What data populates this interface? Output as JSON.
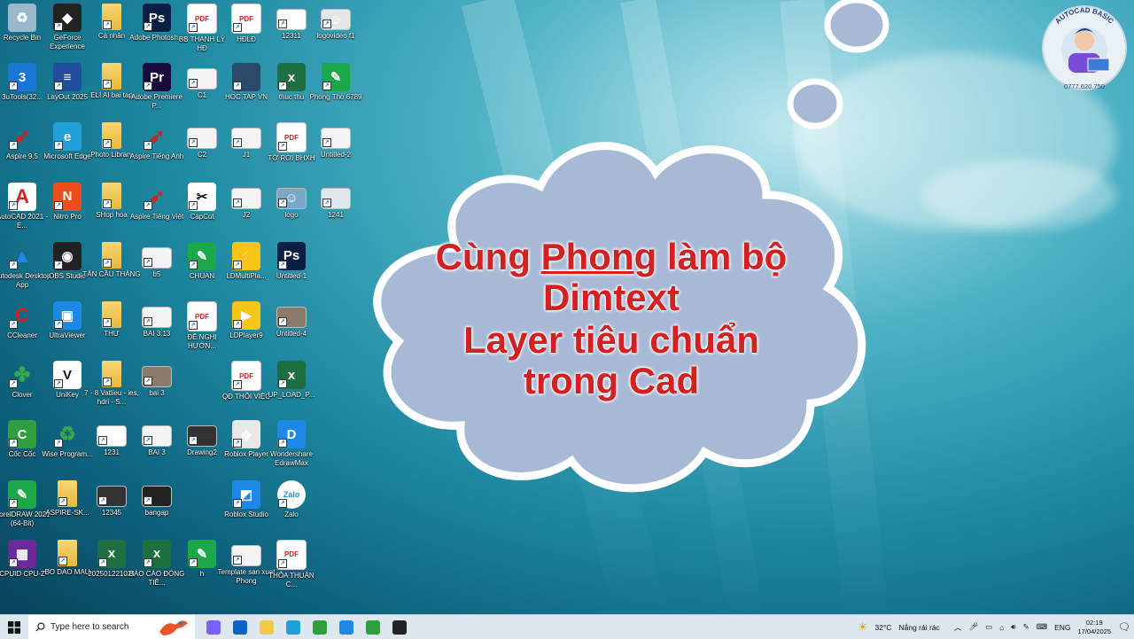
{
  "desktop": {
    "icons": [
      {
        "label": "Recycle Bin",
        "icon": "recycle-bin-icon",
        "color": "#9ab8cc",
        "glyph": "♻"
      },
      {
        "label": "GeForce Experience",
        "icon": "geforce-icon",
        "color": "#222",
        "glyph": "◆"
      },
      {
        "label": "Cá nhân",
        "icon": "folder-icon",
        "color": "#f2c94c",
        "glyph": ""
      },
      {
        "label": "Adobe Photosh...",
        "icon": "photoshop-icon",
        "color": "#0a1f44",
        "glyph": "Ps"
      },
      {
        "label": "BB THANH LÝ HĐ",
        "icon": "pdf-icon",
        "color": "#ffffff",
        "glyph": "PDF"
      },
      {
        "label": "HĐLĐ",
        "icon": "pdf-icon",
        "color": "#ffffff",
        "glyph": "PDF"
      },
      {
        "label": "12311",
        "icon": "file-icon",
        "color": "#ffffff",
        "glyph": ""
      },
      {
        "label": "logovideo f1",
        "icon": "image-icon",
        "color": "#e6e6e6",
        "glyph": "☺"
      },
      {
        "label": "3uTools(32...",
        "icon": "3utools-icon",
        "color": "#1976d2",
        "glyph": "3"
      },
      {
        "label": "LayOut 2025",
        "icon": "layout-icon",
        "color": "#1e4e9c",
        "glyph": "≡"
      },
      {
        "label": "ELI AI bai tap",
        "icon": "folder-icon",
        "color": "#f2c94c",
        "glyph": ""
      },
      {
        "label": "Adobe Premiere P...",
        "icon": "premiere-icon",
        "color": "#1a0b3d",
        "glyph": "Pr"
      },
      {
        "label": "C1",
        "icon": "image-icon",
        "color": "#f4f4f4",
        "glyph": ""
      },
      {
        "label": "HOC TAP VN",
        "icon": "dark-file-icon",
        "color": "#2b4a6a",
        "glyph": ""
      },
      {
        "label": "thuc thu",
        "icon": "excel-icon",
        "color": "#1d6f42",
        "glyph": "x"
      },
      {
        "label": "Phong Tho 6789",
        "icon": "coreldraw-icon",
        "color": "#1aa84a",
        "glyph": "✎"
      },
      {
        "label": "Aspire 9.5",
        "icon": "aspire-icon",
        "color": "transparent",
        "glyph": "➶"
      },
      {
        "label": "Microsoft Edge",
        "icon": "edge-icon",
        "color": "#1fa0d6",
        "glyph": "e"
      },
      {
        "label": "Photo Library",
        "icon": "folder-icon",
        "color": "#f2c94c",
        "glyph": ""
      },
      {
        "label": "Aspire Tiếng Anh",
        "icon": "aspire-icon",
        "color": "transparent",
        "glyph": "➶"
      },
      {
        "label": "C2",
        "icon": "image-icon",
        "color": "#f4f4f4",
        "glyph": ""
      },
      {
        "label": "J1",
        "icon": "image-icon",
        "color": "#f4f4f4",
        "glyph": ""
      },
      {
        "label": "TỜ RỜI BHXH",
        "icon": "pdf-icon",
        "color": "#ffffff",
        "glyph": "PDF"
      },
      {
        "label": "Untitled-2",
        "icon": "image-icon",
        "color": "#f4f4f4",
        "glyph": ""
      },
      {
        "label": "AutoCAD 2021 - E...",
        "icon": "autocad-icon",
        "color": "#ffffff",
        "glyph": "A"
      },
      {
        "label": "Nitro Pro",
        "icon": "nitro-icon",
        "color": "#e94e1b",
        "glyph": "N"
      },
      {
        "label": "SHop hoa",
        "icon": "folder-icon",
        "color": "#f2c94c",
        "glyph": ""
      },
      {
        "label": "Aspire Tiếng Việt",
        "icon": "aspire-icon",
        "color": "transparent",
        "glyph": "➶"
      },
      {
        "label": "CapCut",
        "icon": "capcut-icon",
        "color": "#ffffff",
        "glyph": "✂"
      },
      {
        "label": "J2",
        "icon": "image-icon",
        "color": "#f4f4f4",
        "glyph": ""
      },
      {
        "label": "logo",
        "icon": "image-icon",
        "color": "#7aa7c7",
        "glyph": "☺"
      },
      {
        "label": "1241",
        "icon": "image-icon",
        "color": "#e0e8ee",
        "glyph": ""
      },
      {
        "label": "Autodesk Desktop App",
        "icon": "autodesk-icon",
        "color": "transparent",
        "glyph": "▲"
      },
      {
        "label": "OBS Studio",
        "icon": "obs-icon",
        "color": "#222",
        "glyph": "◉"
      },
      {
        "label": "TÂN CẦU THĂNG",
        "icon": "folder-icon",
        "color": "#f2c94c",
        "glyph": ""
      },
      {
        "label": "b5",
        "icon": "image-icon",
        "color": "#f4f4f4",
        "glyph": ""
      },
      {
        "label": "CHUAN",
        "icon": "coreldraw-icon",
        "color": "#1aa84a",
        "glyph": "✎"
      },
      {
        "label": "LDMultiPla...",
        "icon": "ldplayer-icon",
        "color": "#f5c518",
        "glyph": "⚡"
      },
      {
        "label": "Untitled-1",
        "icon": "psb-icon",
        "color": "#0a1f44",
        "glyph": "Ps"
      },
      {
        "label": "CCleaner",
        "icon": "ccleaner-icon",
        "color": "transparent",
        "glyph": "C"
      },
      {
        "label": "UltraViewer",
        "icon": "ultraviewer-icon",
        "color": "#1e88e5",
        "glyph": "▣"
      },
      {
        "label": "THƯ",
        "icon": "folder-icon",
        "color": "#f2c94c",
        "glyph": ""
      },
      {
        "label": "BAI 3.13",
        "icon": "image-icon",
        "color": "#f4f4f4",
        "glyph": ""
      },
      {
        "label": "ĐỀ NGHỊ HƯỚN...",
        "icon": "pdf-icon",
        "color": "#ffffff",
        "glyph": "PDF"
      },
      {
        "label": "LDPlayer9",
        "icon": "ldplayer-icon",
        "color": "#f5c518",
        "glyph": "▶"
      },
      {
        "label": "Untitled-4",
        "icon": "image-icon",
        "color": "#8a7a6a",
        "glyph": ""
      },
      {
        "label": "Clover",
        "icon": "clover-icon",
        "color": "transparent",
        "glyph": "✤"
      },
      {
        "label": "UniKey",
        "icon": "unikey-icon",
        "color": "#ffffff",
        "glyph": "V"
      },
      {
        "label": "7 - 8 Vatlieu - ies, hdri - S...",
        "icon": "folder-icon",
        "color": "#f2c94c",
        "glyph": ""
      },
      {
        "label": "bai 3",
        "icon": "image-icon",
        "color": "#8a7a6a",
        "glyph": ""
      },
      {
        "label": "QĐ THÔI VIỆC",
        "icon": "pdf-icon",
        "color": "#ffffff",
        "glyph": "PDF"
      },
      {
        "label": "UP_LOAD_P...",
        "icon": "excel-icon",
        "color": "#1d6f42",
        "glyph": "x"
      },
      {
        "label": "Cốc Cốc",
        "icon": "coccoc-icon",
        "color": "#2e9e3e",
        "glyph": "C"
      },
      {
        "label": "Wise Program...",
        "icon": "wise-icon",
        "color": "transparent",
        "glyph": "♻"
      },
      {
        "label": "1231",
        "icon": "file-icon",
        "color": "#ffffff",
        "glyph": ""
      },
      {
        "label": "BAI 3",
        "icon": "image-icon",
        "color": "#f4f4f4",
        "glyph": ""
      },
      {
        "label": "Drawing2",
        "icon": "image-icon",
        "color": "#333",
        "glyph": ""
      },
      {
        "label": "Roblox Player",
        "icon": "roblox-icon",
        "color": "#e8e8e8",
        "glyph": "◆"
      },
      {
        "label": "Wondershare EdrawMax",
        "icon": "edraw-icon",
        "color": "#1e88e5",
        "glyph": "D"
      },
      {
        "label": "CorelDRAW 2021 (64-Bit)",
        "icon": "coreldraw-icon",
        "color": "#1aa84a",
        "glyph": "✎"
      },
      {
        "label": "ASPIRE-SK...",
        "icon": "folder-icon",
        "color": "#f2c94c",
        "glyph": ""
      },
      {
        "label": "12345",
        "icon": "image-icon",
        "color": "#333",
        "glyph": ""
      },
      {
        "label": "bangap",
        "icon": "image-icon",
        "color": "#222",
        "glyph": ""
      },
      {
        "label": "Roblox Studio",
        "icon": "roblox-studio-icon",
        "color": "#1e88e5",
        "glyph": "◩"
      },
      {
        "label": "Zalo",
        "icon": "zalo-icon",
        "color": "#ffffff",
        "glyph": "Zalo"
      },
      {
        "label": "CPUID CPU-Z",
        "icon": "cpuz-icon",
        "color": "#6a2a9a",
        "glyph": "▦"
      },
      {
        "label": "BO DAO MAU",
        "icon": "folder-icon",
        "color": "#f2c94c",
        "glyph": ""
      },
      {
        "label": "202501221021",
        "icon": "excel-icon",
        "color": "#1d6f42",
        "glyph": "x"
      },
      {
        "label": "BÁO CÁO ĐÓNG TIỀ...",
        "icon": "excel-icon",
        "color": "#1d6f42",
        "glyph": "x"
      },
      {
        "label": "h",
        "icon": "coreldraw-icon",
        "color": "#1aa84a",
        "glyph": "✎"
      },
      {
        "label": "Template san xuat Phong",
        "icon": "image-icon",
        "color": "#f4f4f4",
        "glyph": ""
      },
      {
        "label": "THỎA THUẬN C...",
        "icon": "pdf-icon",
        "color": "#ffffff",
        "glyph": "PDF"
      }
    ]
  },
  "overlay": {
    "line1_a": "Cùng ",
    "line1_b": "Phong",
    "line1_c": " làm bộ",
    "line2": "Dimtext",
    "line3": "Layer tiêu chuẩn",
    "line4": "trong Cad",
    "text_color": "#d32020"
  },
  "logo": {
    "arc_text": "AUTOCAD BASIC",
    "phone": "0777.620.750"
  },
  "taskbar": {
    "search_placeholder": "Type here to search",
    "weather_temp": "32°C",
    "weather_text": "Nắng rải rác",
    "language": "ENG",
    "time": "02:19",
    "date": "17/04/2025",
    "apps": [
      {
        "name": "copilot-icon",
        "color": "#7b61ff"
      },
      {
        "name": "outlook-icon",
        "color": "#0a64c8"
      },
      {
        "name": "file-explorer-icon",
        "color": "#f2c94c"
      },
      {
        "name": "edge-icon",
        "color": "#1fa0d6"
      },
      {
        "name": "coccoc-icon",
        "color": "#2e9e3e"
      },
      {
        "name": "zalo-icon",
        "color": "#1e88e5"
      },
      {
        "name": "clover-icon",
        "color": "#2e9e3e"
      },
      {
        "name": "screen-recorder-icon",
        "color": "#222"
      }
    ]
  }
}
